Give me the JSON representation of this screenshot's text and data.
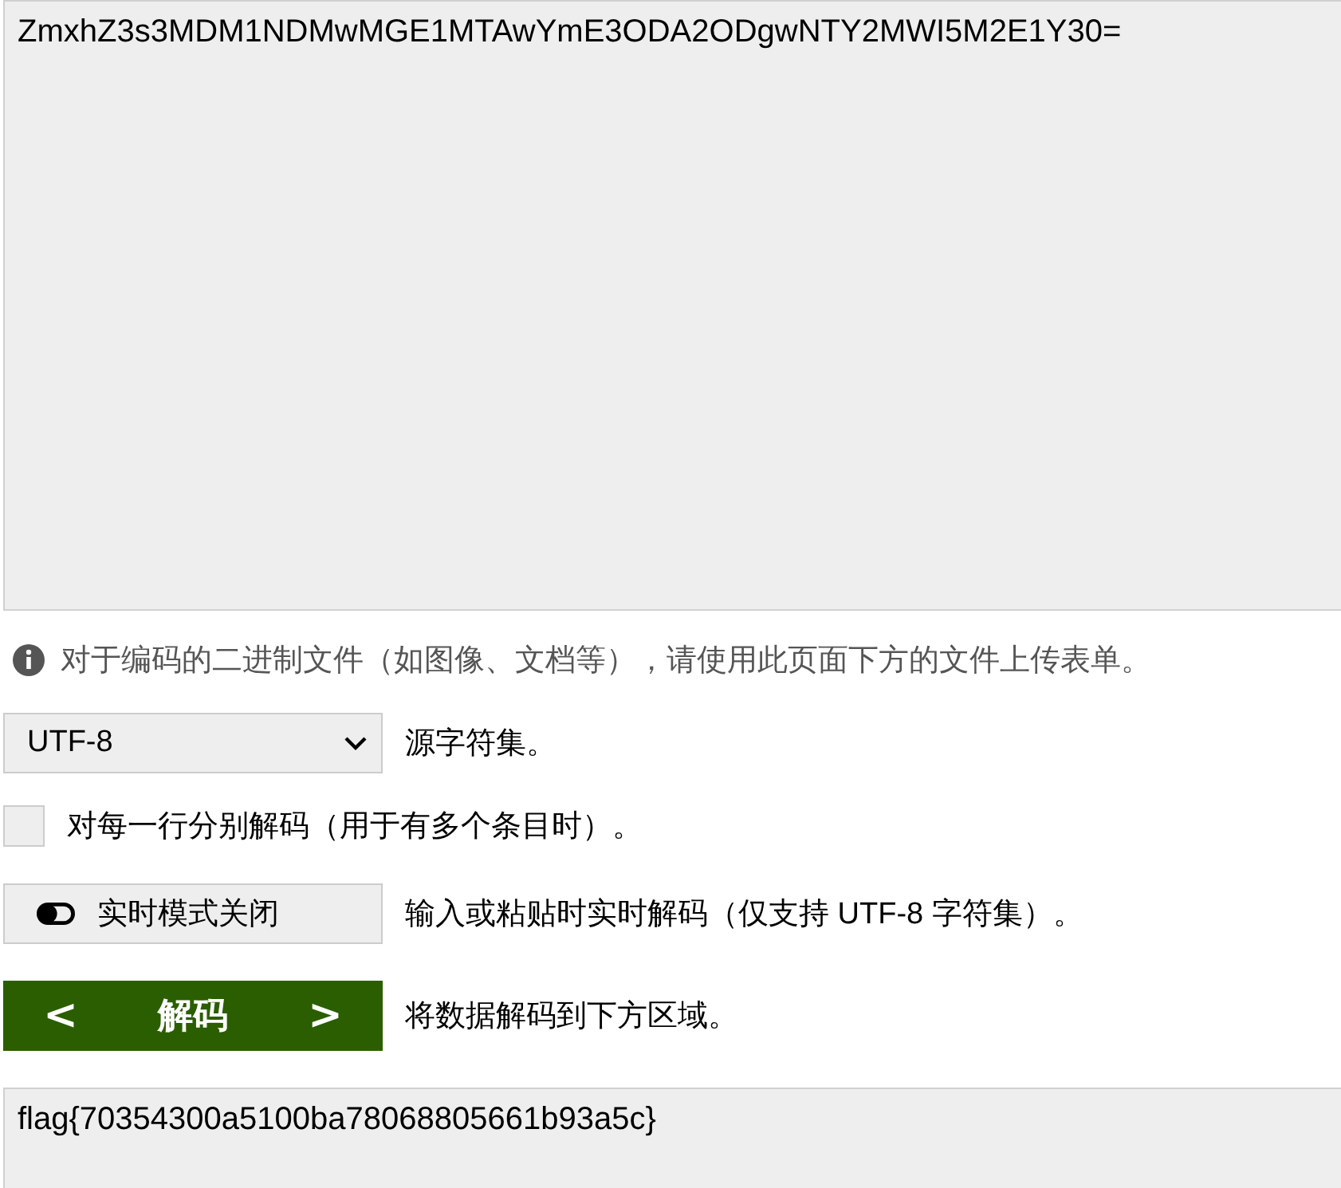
{
  "input": {
    "value": "ZmxhZ3s3MDM1NDMwMGE1MTAwYmE3ODA2ODgwNTY2MWI5M2E1Y30="
  },
  "info": {
    "text": "对于编码的二进制文件（如图像、文档等），请使用此页面下方的文件上传表单。"
  },
  "charset": {
    "value": "UTF-8",
    "label": "源字符集。"
  },
  "per_line": {
    "checked": false,
    "label": "对每一行分别解码（用于有多个条目时）。"
  },
  "live_mode": {
    "on": false,
    "button": "实时模式关闭",
    "label": "输入或粘贴时实时解码（仅支持 UTF-8 字符集）。"
  },
  "decode": {
    "button": "解码",
    "prev": "<",
    "next": ">",
    "label": "将数据解码到下方区域。"
  },
  "output": {
    "value": "flag{70354300a5100ba78068805661b93a5c}"
  }
}
